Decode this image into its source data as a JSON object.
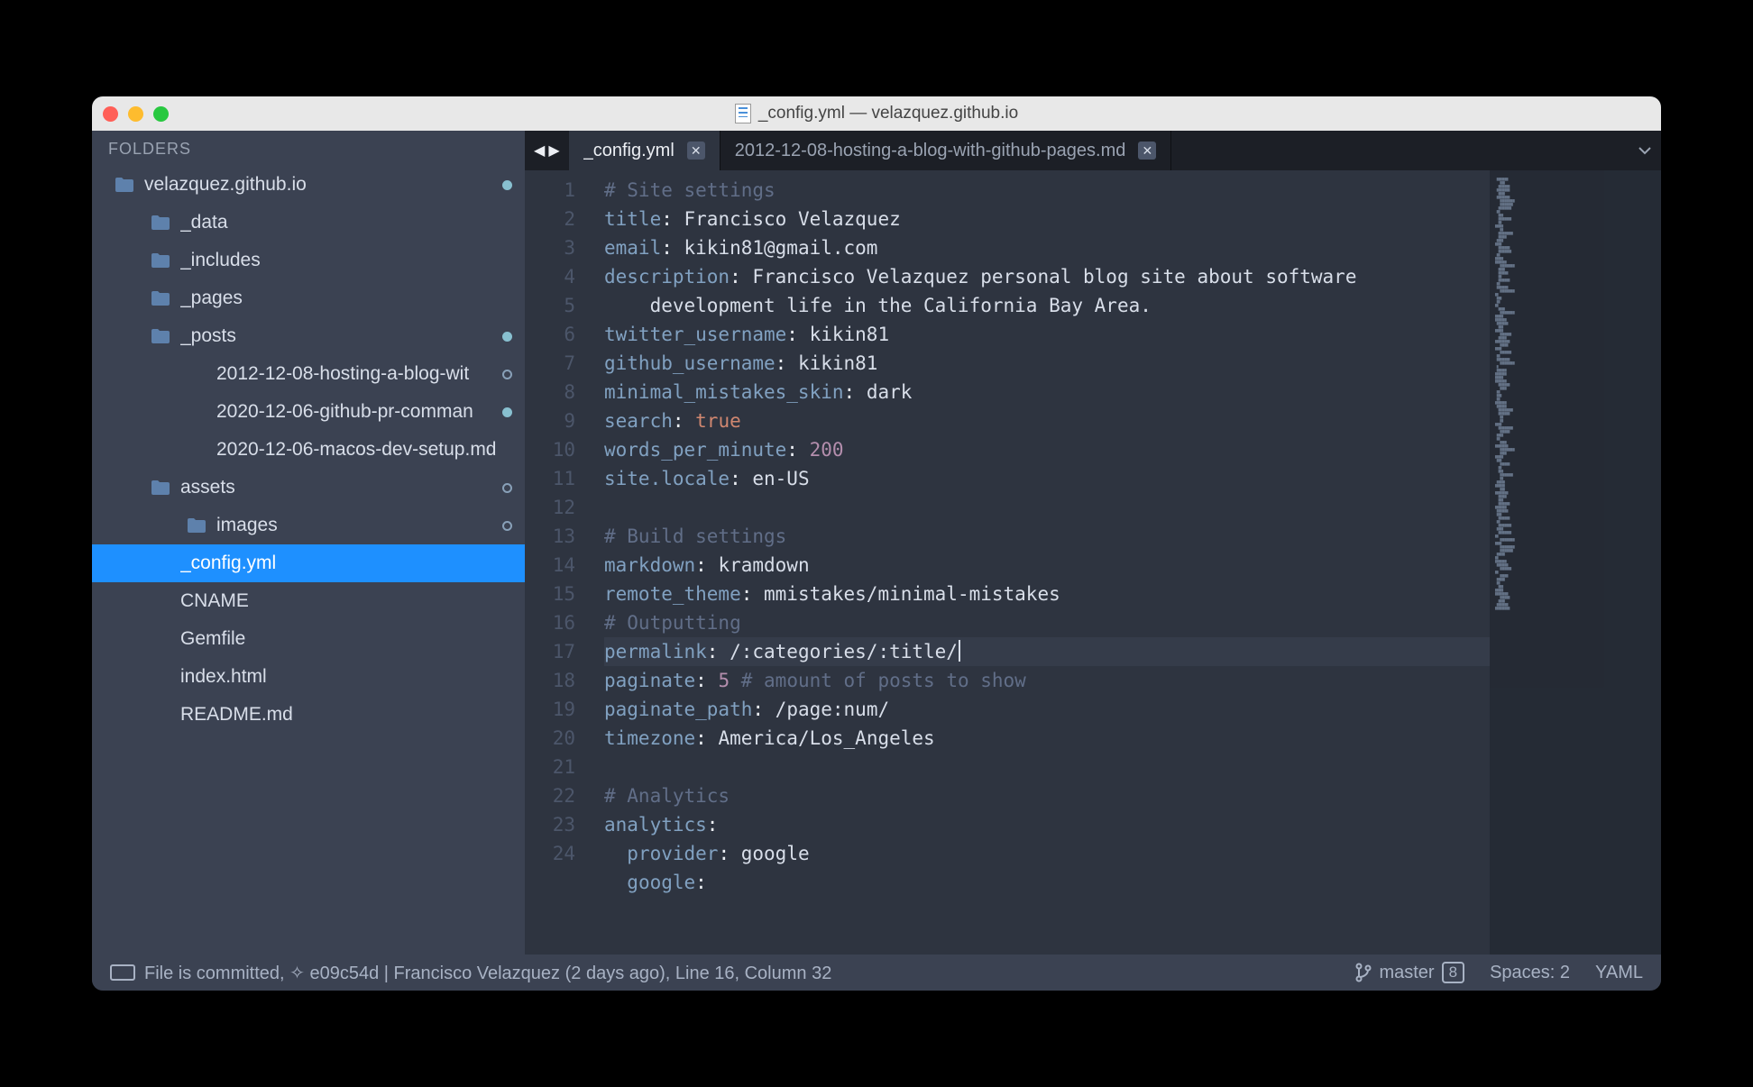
{
  "window": {
    "title": "_config.yml — velazquez.github.io"
  },
  "sidebar": {
    "header": "FOLDERS",
    "tree": [
      {
        "label": "velazquez.github.io",
        "type": "folder",
        "indent": 0,
        "status": "filled"
      },
      {
        "label": "_data",
        "type": "folder",
        "indent": 1
      },
      {
        "label": "_includes",
        "type": "folder",
        "indent": 1
      },
      {
        "label": "_pages",
        "type": "folder",
        "indent": 1
      },
      {
        "label": "_posts",
        "type": "folder",
        "indent": 1,
        "status": "filled"
      },
      {
        "label": "2012-12-08-hosting-a-blog-wit",
        "type": "file",
        "indent": 2,
        "status": "open"
      },
      {
        "label": "2020-12-06-github-pr-comman",
        "type": "file",
        "indent": 2,
        "status": "filled"
      },
      {
        "label": "2020-12-06-macos-dev-setup.md",
        "type": "file",
        "indent": 2
      },
      {
        "label": "assets",
        "type": "folder",
        "indent": 1,
        "status": "open"
      },
      {
        "label": "images",
        "type": "folder",
        "indent": 2,
        "status": "open"
      },
      {
        "label": "_config.yml",
        "type": "file",
        "indent": 1,
        "selected": true
      },
      {
        "label": "CNAME",
        "type": "file",
        "indent": 1
      },
      {
        "label": "Gemfile",
        "type": "file",
        "indent": 1
      },
      {
        "label": "index.html",
        "type": "file",
        "indent": 1
      },
      {
        "label": "README.md",
        "type": "file",
        "indent": 1
      }
    ]
  },
  "tabs": {
    "items": [
      {
        "label": "_config.yml",
        "active": true
      },
      {
        "label": "2012-12-08-hosting-a-blog-with-github-pages.md",
        "active": false
      }
    ]
  },
  "editor": {
    "lines": [
      [
        {
          "t": "comment",
          "v": "# Site settings"
        }
      ],
      [
        {
          "t": "key",
          "v": "title"
        },
        {
          "t": "punct",
          "v": ": "
        },
        {
          "t": "str",
          "v": "Francisco Velazquez"
        }
      ],
      [
        {
          "t": "key",
          "v": "email"
        },
        {
          "t": "punct",
          "v": ": "
        },
        {
          "t": "str",
          "v": "kikin81@gmail.com"
        }
      ],
      [
        {
          "t": "key",
          "v": "description"
        },
        {
          "t": "punct",
          "v": ": "
        },
        {
          "t": "str",
          "v": "Francisco Velazquez personal blog site about software"
        }
      ],
      [
        {
          "t": "str",
          "v": "    development life in the California Bay Area."
        }
      ],
      [
        {
          "t": "key",
          "v": "twitter_username"
        },
        {
          "t": "punct",
          "v": ": "
        },
        {
          "t": "str",
          "v": "kikin81"
        }
      ],
      [
        {
          "t": "key",
          "v": "github_username"
        },
        {
          "t": "punct",
          "v": ": "
        },
        {
          "t": "str",
          "v": "kikin81"
        }
      ],
      [
        {
          "t": "key",
          "v": "minimal_mistakes_skin"
        },
        {
          "t": "punct",
          "v": ": "
        },
        {
          "t": "str",
          "v": "dark"
        }
      ],
      [
        {
          "t": "key",
          "v": "search"
        },
        {
          "t": "punct",
          "v": ": "
        },
        {
          "t": "bool",
          "v": "true"
        }
      ],
      [
        {
          "t": "key",
          "v": "words_per_minute"
        },
        {
          "t": "punct",
          "v": ": "
        },
        {
          "t": "num",
          "v": "200"
        }
      ],
      [
        {
          "t": "key",
          "v": "site.locale"
        },
        {
          "t": "punct",
          "v": ": "
        },
        {
          "t": "str",
          "v": "en-US"
        }
      ],
      [],
      [
        {
          "t": "comment",
          "v": "# Build settings"
        }
      ],
      [
        {
          "t": "key",
          "v": "markdown"
        },
        {
          "t": "punct",
          "v": ": "
        },
        {
          "t": "str",
          "v": "kramdown"
        }
      ],
      [
        {
          "t": "key",
          "v": "remote_theme"
        },
        {
          "t": "punct",
          "v": ": "
        },
        {
          "t": "str",
          "v": "mmistakes/minimal-mistakes"
        }
      ],
      [
        {
          "t": "comment",
          "v": "# Outputting"
        }
      ],
      [
        {
          "t": "key",
          "v": "permalink"
        },
        {
          "t": "punct",
          "v": ": "
        },
        {
          "t": "str",
          "v": "/:categories/:title/"
        },
        {
          "t": "cursor",
          "v": ""
        }
      ],
      [
        {
          "t": "key",
          "v": "paginate"
        },
        {
          "t": "punct",
          "v": ": "
        },
        {
          "t": "num",
          "v": "5"
        },
        {
          "t": "comment",
          "v": " # amount of posts to show"
        }
      ],
      [
        {
          "t": "key",
          "v": "paginate_path"
        },
        {
          "t": "punct",
          "v": ": "
        },
        {
          "t": "str",
          "v": "/page:num/"
        }
      ],
      [
        {
          "t": "key",
          "v": "timezone"
        },
        {
          "t": "punct",
          "v": ": "
        },
        {
          "t": "str",
          "v": "America/Los_Angeles"
        }
      ],
      [],
      [
        {
          "t": "comment",
          "v": "# Analytics"
        }
      ],
      [
        {
          "t": "key",
          "v": "analytics"
        },
        {
          "t": "punct",
          "v": ":"
        }
      ],
      [
        {
          "t": "str",
          "v": "  "
        },
        {
          "t": "key",
          "v": "provider"
        },
        {
          "t": "punct",
          "v": ": "
        },
        {
          "t": "str",
          "v": "google"
        }
      ],
      [
        {
          "t": "str",
          "v": "  "
        },
        {
          "t": "key",
          "v": "google"
        },
        {
          "t": "punct",
          "v": ":"
        }
      ]
    ],
    "gutter": [
      "1",
      "2",
      "3",
      "4",
      "",
      "5",
      "6",
      "7",
      "8",
      "9",
      "10",
      "11",
      "12",
      "13",
      "14",
      "15",
      "16",
      "17",
      "18",
      "19",
      "20",
      "21",
      "22",
      "23",
      "24"
    ],
    "current_line_index": 16
  },
  "statusbar": {
    "commit_text": "File is committed, ✧ e09c54d | Francisco Velazquez (2 days ago), Line 16, Column 32",
    "branch_name": "master",
    "branch_count": "8",
    "spaces": "Spaces: 2",
    "syntax": "YAML"
  }
}
